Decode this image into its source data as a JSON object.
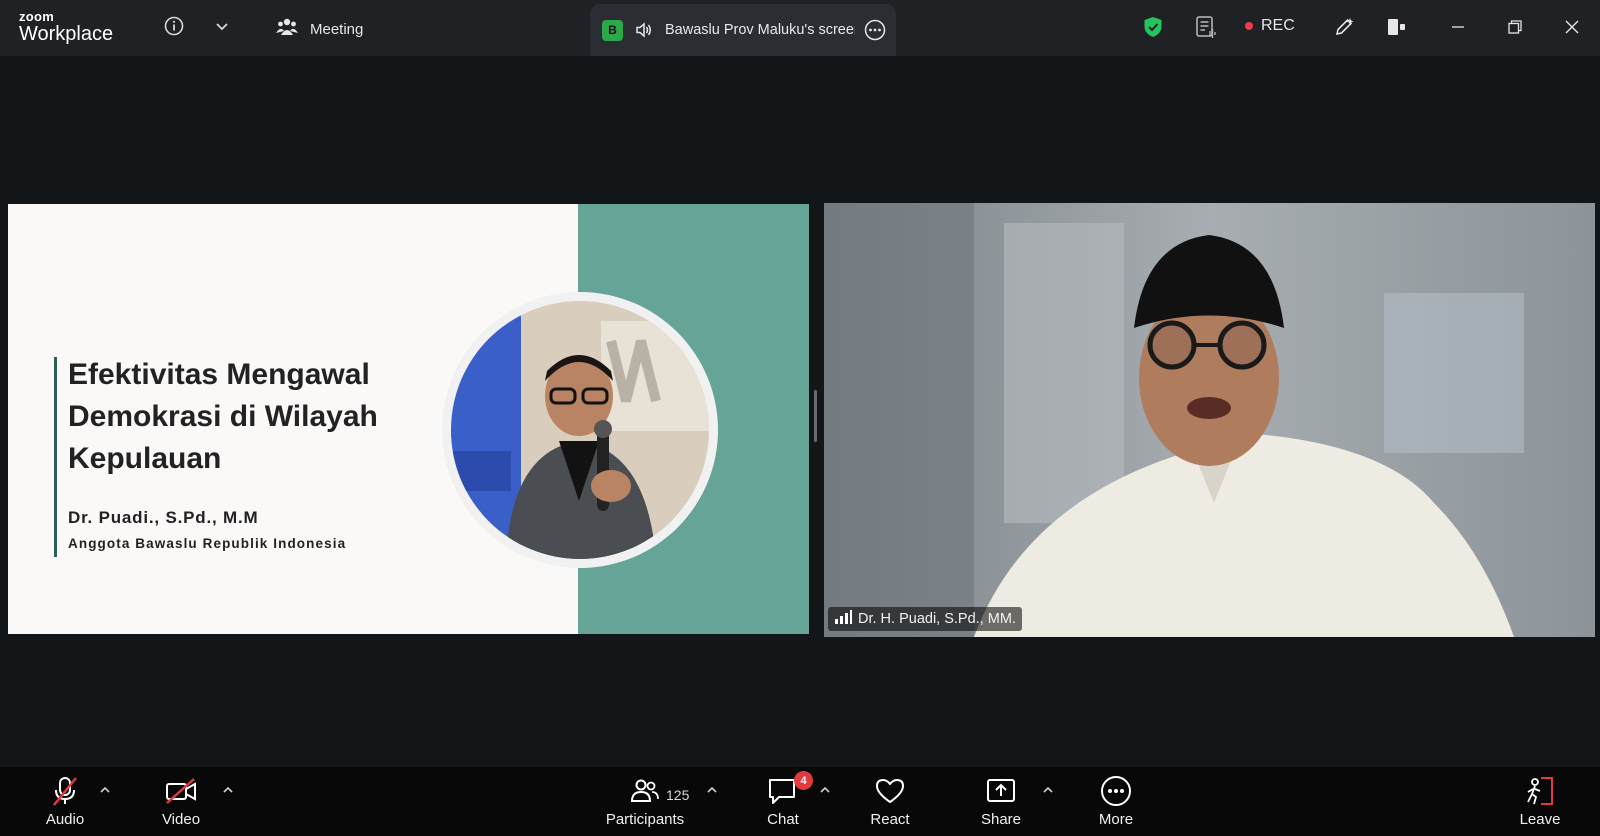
{
  "app": {
    "brand_small": "zoom",
    "brand_large": "Workplace"
  },
  "header": {
    "meeting_label": "Meeting",
    "share_tab": {
      "badge": "B",
      "title": "Bawaslu Prov Maluku's screen"
    },
    "rec_label": "REC"
  },
  "slide": {
    "heading_lines": [
      "Efektivitas Mengawal",
      "Demokrasi di Wilayah",
      "Kepulauan"
    ],
    "speaker_name": "Dr. Puadi., S.Pd., M.M",
    "speaker_role": "Anggota Bawaslu Republik Indonesia"
  },
  "video": {
    "participant_name": "Dr. H. Puadi, S.Pd., MM."
  },
  "toolbar": {
    "audio": "Audio",
    "video": "Video",
    "participants": "Participants",
    "participant_count": "125",
    "chat": "Chat",
    "chat_unread": "4",
    "react": "React",
    "share": "Share",
    "more": "More",
    "leave": "Leave"
  },
  "colors": {
    "topbar": "#1f2124",
    "background": "#131619",
    "slide_teal": "#65a497",
    "rec_dot": "#ef3b4a",
    "shield_green": "#22c55e",
    "leave_red": "#e03a3e"
  }
}
